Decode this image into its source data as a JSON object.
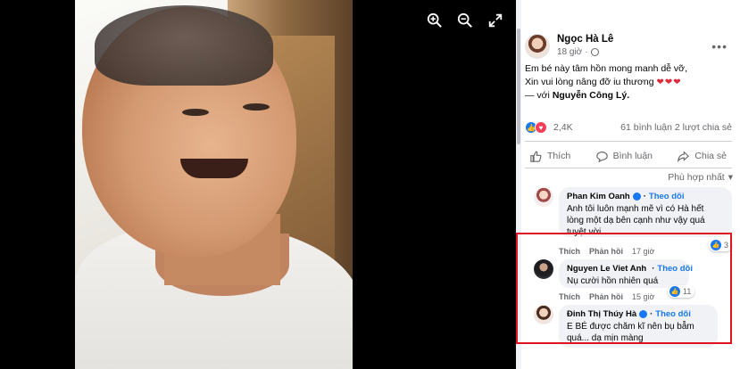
{
  "viewer": {
    "tools": [
      {
        "name": "zoom-in",
        "icon": "zoom-in-icon"
      },
      {
        "name": "zoom-out",
        "icon": "zoom-out-icon"
      },
      {
        "name": "fullscreen",
        "icon": "fullscreen-icon"
      }
    ]
  },
  "post": {
    "author": "Ngọc Hà Lê",
    "time": "18 giờ",
    "caption_line1": "Em bé này tâm hồn mong manh dễ vỡ,",
    "caption_line2": "Xin vui lòng nâng đỡ iu thương",
    "caption_hearts": "❤❤❤",
    "with_prefix": "— với",
    "with_name": "Nguyễn Công Lý.",
    "reaction_count": "2,4K",
    "comments_count": "61 bình luận",
    "shares_count": "2 lượt chia sẻ",
    "actions": {
      "like": "Thích",
      "comment": "Bình luận",
      "share": "Chia sẻ"
    },
    "sort_label": "Phù hợp nhất"
  },
  "comments": [
    {
      "name": "Phan Kim Oanh",
      "follow": "Theo dõi",
      "text_line1": "Anh tôi luôn mạnh mẽ vì có Hà hết",
      "text_line2": "lòng một dạ bên cạnh như vậy quá",
      "text_line3": "tuyệt vời",
      "like_label": "Thích",
      "reply_label": "Phản hồi",
      "time": "17 giờ",
      "reactions": "3"
    },
    {
      "name": "Nguyen Le Viet Anh",
      "follow": "Theo dõi",
      "text_line1": "Nụ cười hồn nhiên quá",
      "like_label": "Thích",
      "reply_label": "Phản hồi",
      "time": "15 giờ",
      "reactions": "11"
    },
    {
      "name": "Đinh Thị Thúy Hà",
      "follow": "Theo dõi",
      "text_line1": "E BÉ được chăm kĩ nên bụ bẫm",
      "text_line2": "quá... dạ mịn màng"
    }
  ],
  "colors": {
    "accent": "#1877f2",
    "highlight": "#e0141e"
  }
}
